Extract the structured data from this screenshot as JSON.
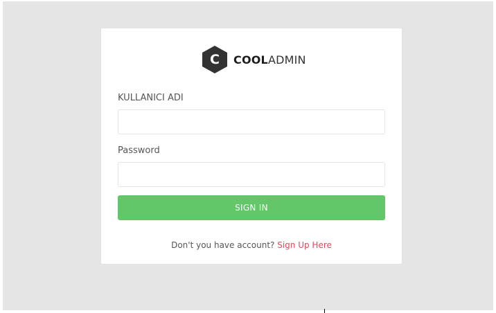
{
  "brand": {
    "logo_letter": "C",
    "name_bold": "COOL",
    "name_light": "ADMIN",
    "logo_color": "#333333"
  },
  "login_form": {
    "username_label": "KULLANICI ADI",
    "username_value": "",
    "password_label": "Password",
    "password_value": "",
    "signin_label": "SIGN IN",
    "signin_color": "#63c76a"
  },
  "signup": {
    "prompt": "Don't you have account? ",
    "link_label": "Sign Up Here",
    "link_color": "#e0475a"
  },
  "colors": {
    "background": "#e5e5e5",
    "card": "#ffffff"
  }
}
